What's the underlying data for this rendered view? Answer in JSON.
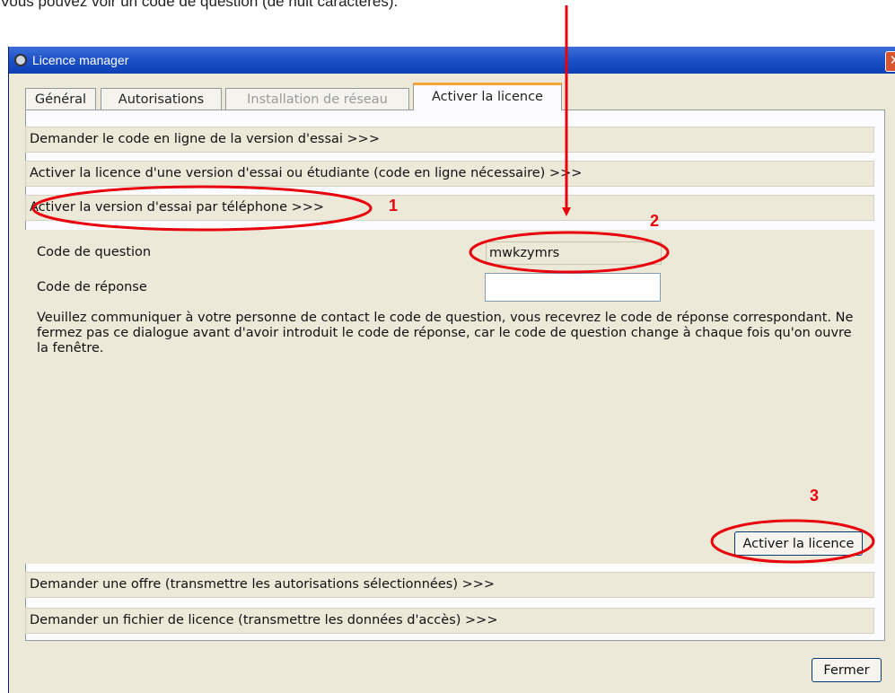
{
  "caption": "Vous pouvez voir un code de question (de huit caractères).",
  "window": {
    "title": "Licence manager",
    "close_glyph": "✕"
  },
  "tabs": [
    {
      "label": "Général",
      "state": "normal"
    },
    {
      "label": "Autorisations",
      "state": "normal"
    },
    {
      "label": "Installation de réseau",
      "state": "disabled"
    },
    {
      "label": "Activer la licence",
      "state": "active"
    }
  ],
  "sections": {
    "s1": "Demander le code en ligne de la version d'essai >>>",
    "s2": "Activer la licence d'une version d'essai ou étudiante (code en ligne nécessaire) >>>",
    "s3": "Activer la version d'essai par téléphone >>>",
    "s4": "Demander une offre (transmettre les autorisations sélectionnées) >>>",
    "s5": "Demander un fichier de licence (transmettre les données d'accès) >>>"
  },
  "phone_activation": {
    "question_label": "Code de question",
    "question_value": "mwkzymrs",
    "answer_label": "Code de réponse",
    "answer_value": "",
    "info_text": "Veuillez communiquer à votre personne de contact le code de question, vous recevrez le code de réponse correspondant. Ne fermez pas ce dialogue avant d'avoir introduit le code de réponse, car le code de question change à chaque fois qu'on ouvre la fenêtre.",
    "activate_button": "Activer la licence"
  },
  "footer": {
    "close_button": "Fermer"
  },
  "annotations": {
    "n1": "1",
    "n2": "2",
    "n3": "3",
    "color": "#e8000d"
  },
  "colors": {
    "titlebar": "#1e53c9",
    "dialog_bg": "#ece9d8",
    "active_tab_accent": "#f2a63a"
  }
}
